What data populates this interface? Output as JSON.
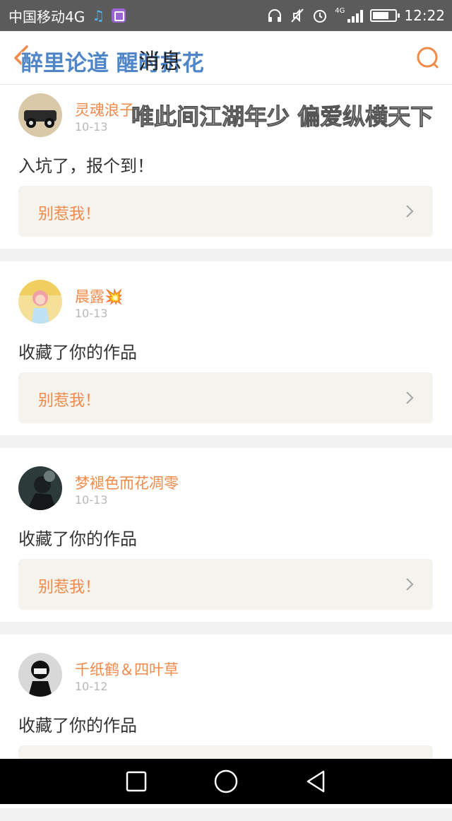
{
  "status_bar": {
    "carrier": "中国移动4G",
    "network_tag": "4G",
    "time": "12:22"
  },
  "header": {
    "title": "消息",
    "watermark_channel": "醉里论道 醒时折花",
    "watermark_tagline": "唯此间江湖年少 偏爱纵横天下"
  },
  "messages": [
    {
      "username": "灵魂浪子",
      "date": "10-13",
      "action": "入坑了，报个到！",
      "work_title": "别惹我！",
      "avatar_colors": [
        "#d9c9a8",
        "#2a2a2a"
      ]
    },
    {
      "username": "晨露💥",
      "date": "10-13",
      "action": "收藏了你的作品",
      "work_title": "别惹我！",
      "avatar_colors": [
        "#f5e09a",
        "#f2a0a8"
      ]
    },
    {
      "username": "梦褪色而花凋零",
      "date": "10-13",
      "action": "收藏了你的作品",
      "work_title": "别惹我！",
      "avatar_colors": [
        "#2d3a3a",
        "#6a7a78"
      ]
    },
    {
      "username": "千纸鹤＆四叶草",
      "date": "10-12",
      "action": "收藏了你的作品",
      "work_title": "",
      "avatar_colors": [
        "#d8d8d8",
        "#111111"
      ]
    }
  ],
  "colors": {
    "accent": "#f08a4b",
    "status_bar_bg": "#5b5b5b",
    "card_box_bg": "#f4f3ee"
  }
}
